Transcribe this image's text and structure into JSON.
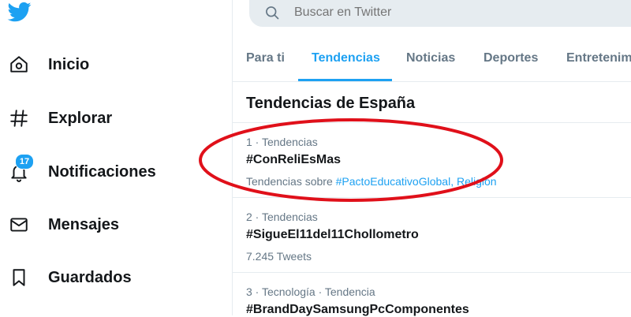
{
  "sidebar": {
    "logo": "twitter-bird-icon",
    "items": [
      {
        "label": "Inicio",
        "icon": "home-icon"
      },
      {
        "label": "Explorar",
        "icon": "hashtag-icon"
      },
      {
        "label": "Notificaciones",
        "icon": "bell-icon",
        "badge": "17"
      },
      {
        "label": "Mensajes",
        "icon": "envelope-icon"
      },
      {
        "label": "Guardados",
        "icon": "bookmark-icon"
      }
    ]
  },
  "search": {
    "placeholder": "Buscar en Twitter"
  },
  "tabs": [
    {
      "label": "Para ti",
      "active": false
    },
    {
      "label": "Tendencias",
      "active": true
    },
    {
      "label": "Noticias",
      "active": false
    },
    {
      "label": "Deportes",
      "active": false
    },
    {
      "label": "Entretenim",
      "active": false
    }
  ],
  "section_title": "Tendencias de España",
  "trends": [
    {
      "meta": "1 · Tendencias",
      "name": "#ConReliEsMas",
      "sub_prefix": "Tendencias sobre ",
      "sub_link1": "#PactoEducativoGlobal",
      "sub_sep": ", ",
      "sub_link2": "Religión"
    },
    {
      "meta": "2 · Tendencias",
      "name": "#SigueEl11del11Chollometro",
      "sub": "7.245 Tweets"
    },
    {
      "meta": "3 · Tecnología · Tendencia",
      "name": "#BrandDaySamsungPcComponentes"
    }
  ],
  "colors": {
    "accent": "#1da1f2",
    "text": "#14171a",
    "muted": "#657786",
    "annotation": "#e0101a"
  }
}
